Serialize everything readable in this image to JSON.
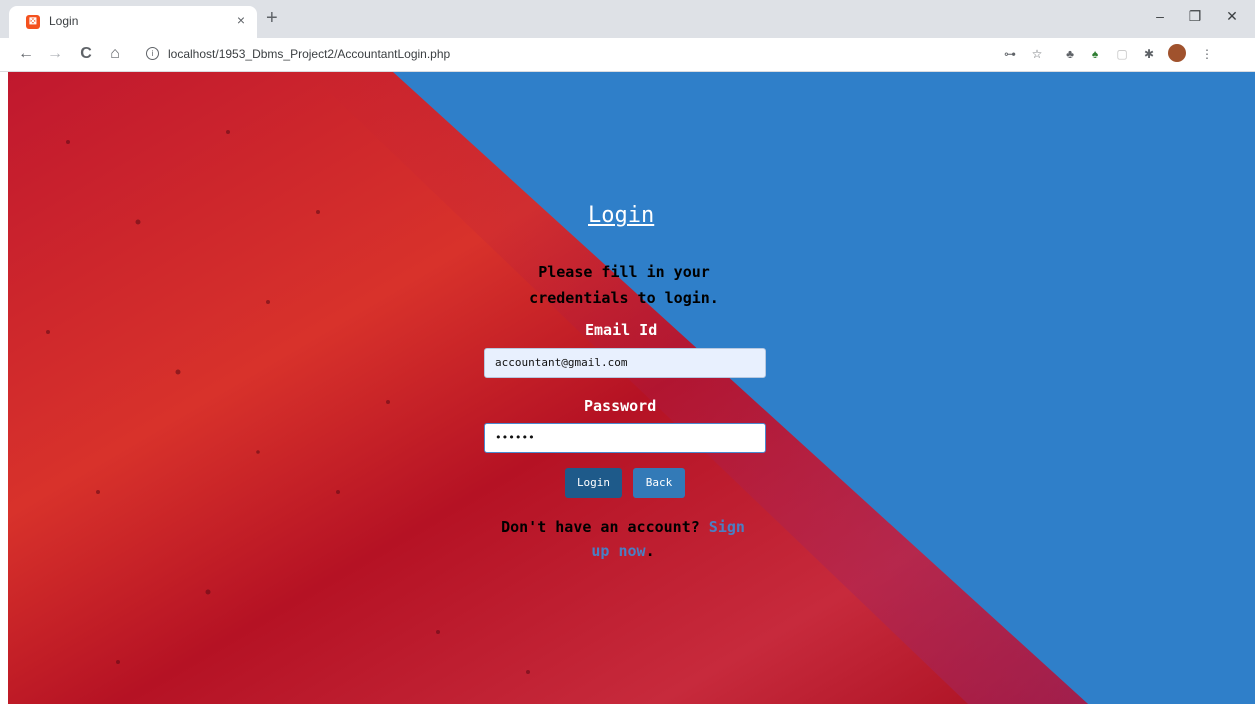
{
  "browser": {
    "tab_title": "Login",
    "tab_close": "×",
    "new_tab": "+",
    "url": "localhost/1953_Dbms_Project2/AccountantLogin.php",
    "favicon_glyph": "⊠",
    "icons": [
      "back-arrow-icon",
      "forward-arrow-icon",
      "reload-icon",
      "home-icon",
      "info-icon",
      "key-icon",
      "star-icon",
      "extension-icon",
      "puzzle-icon",
      "avatar-icon",
      "menu-icon"
    ]
  },
  "window_controls": {
    "minimize": "–",
    "restore": "❐",
    "close": "✕"
  },
  "nav": {
    "back": "←",
    "forward": "→",
    "reload": "C",
    "home": "⌂",
    "info": "i"
  },
  "extensions": {
    "key": "⊶",
    "star": "☆",
    "ext1": "♣",
    "ext2": "♠",
    "ext3": "▢",
    "puzzle": "✱",
    "more": "⋮"
  },
  "login": {
    "title": "Login",
    "subtitle": "Please fill in your credentials to login.",
    "email_label": "Email Id",
    "email_value": "accountant@gmail.com",
    "password_label": "Password",
    "password_value": "••••••",
    "login_button": "Login",
    "back_button": "Back",
    "signup_prefix": "Don't have an account? ",
    "signup_link": "Sign up now",
    "signup_suffix": "."
  },
  "colors": {
    "background_blue": "#2f7fc9",
    "background_red": "#c0182e",
    "login_button": "#1e5a8a",
    "back_button": "#337ab7",
    "link": "#4a7fc4"
  }
}
